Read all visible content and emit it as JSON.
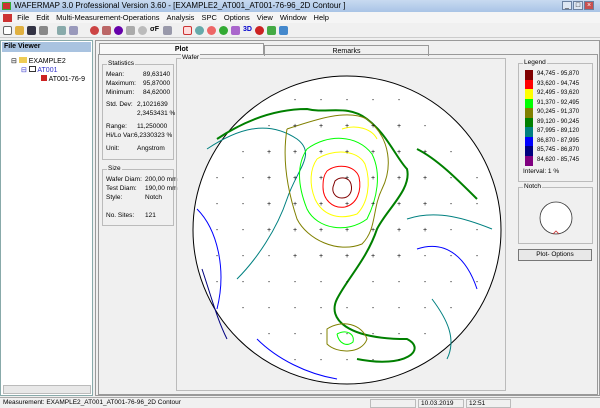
{
  "title": "WAFERMAP 3.0  Professional Version 3.60 - [EXAMPLE2_AT001_AT001-76-96_2D Contour  ]",
  "menu": [
    "File",
    "Edit",
    "Multi-Measurement-Operations",
    "Analysis",
    "SPC",
    "Options",
    "View",
    "Window",
    "Help"
  ],
  "file_viewer": {
    "header": "File Viewer",
    "tree": [
      "EXAMPLE2",
      "AT001",
      "AT001-76-9"
    ]
  },
  "tabs": {
    "plot": "Plot",
    "remarks": "Remarks"
  },
  "statistics": {
    "caption": "Statistics",
    "mean_label": "Mean:",
    "mean": "89,63140",
    "max_label": "Maximum:",
    "max": "95,87000",
    "min_label": "Minimum:",
    "min": "84,62000",
    "std_label": "Std. Dev:",
    "std": "2,1021639",
    "std_pct": "2,3453431 %",
    "range_label": "Range:",
    "range": "11,250000",
    "hilo_label": "Hi/Lo Var:",
    "hilo": "6,2330323 %",
    "unit_label": "Unit:",
    "unit": "Angstrom"
  },
  "size": {
    "caption": "Size",
    "wafer_label": "Wafer Diam:",
    "wafer": "200,00 mm",
    "test_label": "Test Diam:",
    "test": "190,00 mm",
    "style_label": "Style:",
    "style": "Notch",
    "sites_label": "No. Sites:",
    "sites": "121"
  },
  "wafer_caption": "Wafer",
  "legend": {
    "caption": "Legend",
    "items": [
      {
        "range": "94,745 - 95,870",
        "color": "#800000"
      },
      {
        "range": "93,620 - 94,745",
        "color": "#ff0000"
      },
      {
        "range": "92,495 - 93,620",
        "color": "#ffff00"
      },
      {
        "range": "91,370 - 92,495",
        "color": "#00ff00"
      },
      {
        "range": "90,245 - 91,370",
        "color": "#808000"
      },
      {
        "range": "89,120 - 90,245",
        "color": "#008000"
      },
      {
        "range": "87,995 - 89,120",
        "color": "#008080"
      },
      {
        "range": "86,870 - 87,995",
        "color": "#0000ff"
      },
      {
        "range": "85,745 - 86,870",
        "color": "#000080"
      },
      {
        "range": "84,620 - 85,745",
        "color": "#800080"
      }
    ],
    "interval": "Interval:   1 %"
  },
  "notch_caption": "Notch",
  "plot_options": "Plot- Options",
  "status": {
    "measurement": "Measurement: EXAMPLE2_AT001_AT001-76-96_2D Contour",
    "date": "10.03.2019",
    "time": "12:51"
  }
}
